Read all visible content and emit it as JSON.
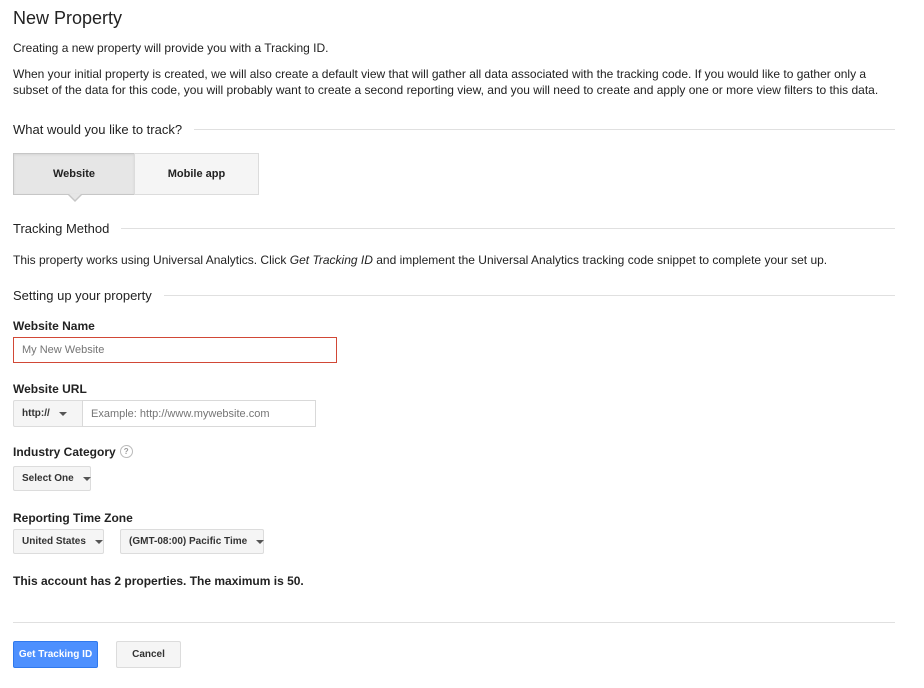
{
  "header": {
    "title": "New Property"
  },
  "intro": {
    "line1": "Creating a new property will provide you with a Tracking ID.",
    "line2": "When your initial property is created, we will also create a default view that will gather all data associated with the tracking code. If you would like to gather only a subset of the data for this code, you will probably want to create a second reporting view, and you will need to create and apply one or more view filters to this data."
  },
  "track": {
    "heading": "What would you like to track?",
    "options": [
      "Website",
      "Mobile app"
    ],
    "selected": "Website"
  },
  "tracking_method": {
    "heading": "Tracking Method",
    "text_before": "This property works using Universal Analytics. Click ",
    "text_emphasis": "Get Tracking ID",
    "text_after": " and implement the Universal Analytics tracking code snippet to complete your set up."
  },
  "setup": {
    "heading": "Setting up your property",
    "website_name": {
      "label": "Website Name",
      "value": "",
      "placeholder": "My New Website"
    },
    "website_url": {
      "label": "Website URL",
      "protocol": "http://",
      "value": "",
      "placeholder": "Example: http://www.mywebsite.com"
    },
    "industry": {
      "label": "Industry Category",
      "help_icon": "?",
      "selected": "Select One"
    },
    "time_zone": {
      "label": "Reporting Time Zone",
      "country": "United States",
      "zone": "(GMT-08:00) Pacific Time"
    },
    "account_note": "This account has 2 properties. The maximum is 50."
  },
  "actions": {
    "primary": "Get Tracking ID",
    "cancel": "Cancel"
  },
  "colors": {
    "primary_button": "#4d90fe",
    "error_border": "#d14836"
  }
}
